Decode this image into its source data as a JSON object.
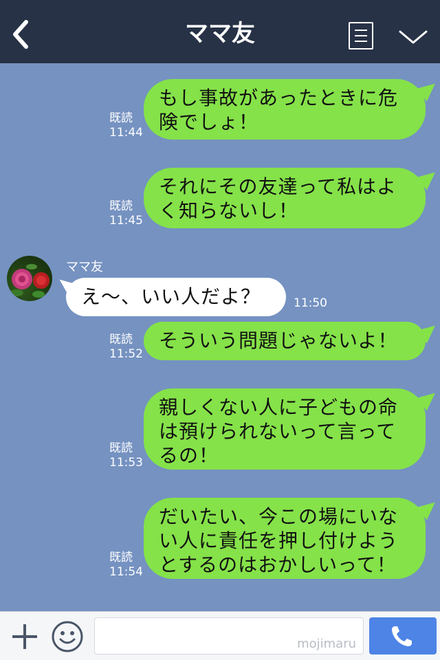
{
  "header": {
    "title": "ママ友"
  },
  "contact": {
    "name": "ママ友"
  },
  "messages": [
    {
      "side": "me",
      "text": "もし事故があったときに危険でしょ！",
      "read": "既読",
      "time": "11:44"
    },
    {
      "side": "me",
      "text": "それにその友達って私はよく知らないし！",
      "read": "既読",
      "time": "11:45"
    },
    {
      "side": "them",
      "text": "え〜、いい人だよ？",
      "time": "11:50"
    },
    {
      "side": "me",
      "text": "そういう問題じゃないよ！",
      "read": "既読",
      "time": "11:52"
    },
    {
      "side": "me",
      "text": "親しくない人に子どもの命は預けられないって言ってるの！",
      "read": "既読",
      "time": "11:53"
    },
    {
      "side": "me",
      "text": "だいたい、今この場にいない人に責任を押し付けようとするのはおかしいって！",
      "read": "既読",
      "time": "11:54"
    }
  ],
  "input_bar": {
    "watermark": "mojimaru"
  },
  "icons": {
    "back": "chevron-left-icon",
    "menu": "list-icon",
    "collapse": "chevron-down-icon",
    "add": "plus-icon",
    "emoji": "smiley-icon",
    "call": "phone-icon"
  },
  "colors": {
    "header": "#273246",
    "background": "#7592c1",
    "my_bubble": "#85e249",
    "their_bubble": "#ffffff",
    "call_button": "#4d84e6"
  }
}
